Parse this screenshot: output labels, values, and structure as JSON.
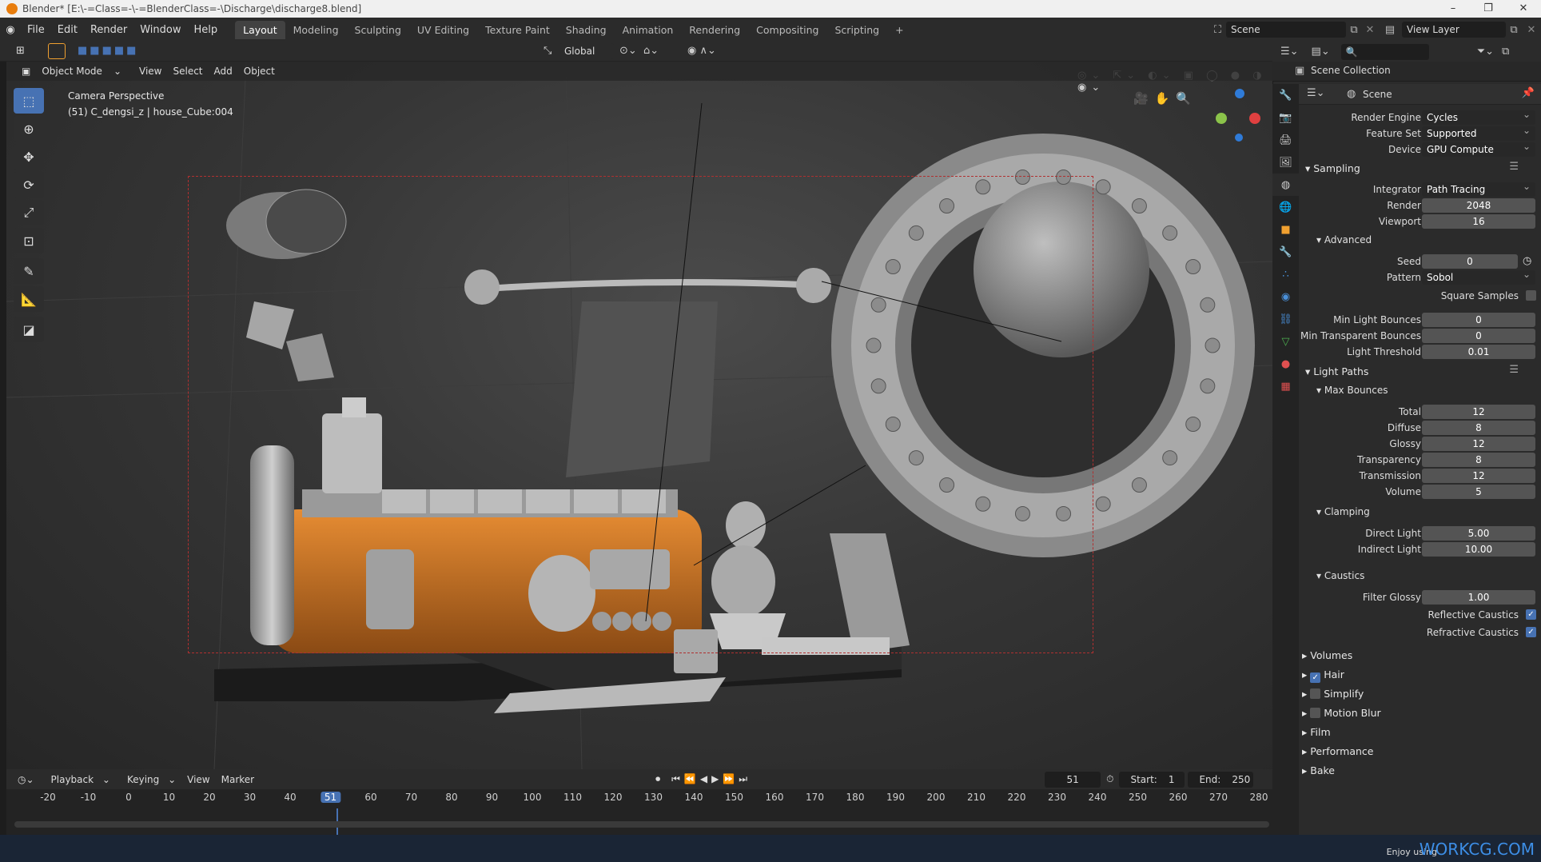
{
  "window": {
    "title": "Blender* [E:\\-=Class=-\\-=BlenderClass=-\\Discharge\\discharge8.blend]"
  },
  "menu": [
    "File",
    "Edit",
    "Render",
    "Window",
    "Help"
  ],
  "workspaces": [
    "Layout",
    "Modeling",
    "Sculpting",
    "UV Editing",
    "Texture Paint",
    "Shading",
    "Animation",
    "Rendering",
    "Compositing",
    "Scripting"
  ],
  "active_workspace": "Layout",
  "scene_field": "Scene",
  "view_layer_field": "View Layer",
  "viewport": {
    "mode": "Object Mode",
    "menus": [
      "View",
      "Select",
      "Add",
      "Object"
    ],
    "orientation": "Global",
    "info_line1": "Camera Perspective",
    "info_line2": "(51) C_dengsi_z | house_Cube:004"
  },
  "outliner": {
    "collection": "Scene Collection"
  },
  "properties": {
    "context": "Scene",
    "render_engine": {
      "label": "Render Engine",
      "value": "Cycles"
    },
    "feature_set": {
      "label": "Feature Set",
      "value": "Supported"
    },
    "device": {
      "label": "Device",
      "value": "GPU Compute"
    },
    "sampling": {
      "title": "Sampling",
      "integrator_label": "Integrator",
      "integrator": "Path Tracing",
      "render_label": "Render",
      "render": "2048",
      "viewport_label": "Viewport",
      "viewport": "16",
      "advanced": "Advanced",
      "seed_label": "Seed",
      "seed": "0",
      "pattern_label": "Pattern",
      "pattern": "Sobol",
      "square_samples": "Square Samples",
      "min_light_bounces_label": "Min Light Bounces",
      "min_light_bounces": "0",
      "min_transparent_bounces_label": "Min Transparent Bounces",
      "min_transparent_bounces": "0",
      "light_threshold_label": "Light Threshold",
      "light_threshold": "0.01"
    },
    "light_paths": {
      "title": "Light Paths",
      "max_bounces": "Max Bounces",
      "total_label": "Total",
      "total": "12",
      "diffuse_label": "Diffuse",
      "diffuse": "8",
      "glossy_label": "Glossy",
      "glossy": "12",
      "transparency_label": "Transparency",
      "transparency": "8",
      "transmission_label": "Transmission",
      "transmission": "12",
      "volume_label": "Volume",
      "volume": "5",
      "clamping": "Clamping",
      "direct_light_label": "Direct Light",
      "direct_light": "5.00",
      "indirect_light_label": "Indirect Light",
      "indirect_light": "10.00",
      "caustics": "Caustics",
      "filter_glossy_label": "Filter Glossy",
      "filter_glossy": "1.00",
      "reflective_caustics": "Reflective Caustics",
      "refractive_caustics": "Refractive Caustics"
    },
    "panels": [
      "Volumes",
      "Hair",
      "Simplify",
      "Motion Blur",
      "Film",
      "Performance",
      "Bake"
    ]
  },
  "timeline": {
    "menus": [
      "Playback",
      "Keying",
      "View",
      "Marker"
    ],
    "current_frame": "51",
    "start_label": "Start:",
    "start": "1",
    "end_label": "End:",
    "end": "250",
    "ticks": [
      "-20",
      "-10",
      "0",
      "10",
      "20",
      "30",
      "40",
      "51",
      "60",
      "70",
      "80",
      "90",
      "100",
      "110",
      "120",
      "130",
      "140",
      "150",
      "160",
      "170",
      "180",
      "190",
      "200",
      "210",
      "220",
      "230",
      "240",
      "250",
      "260",
      "270",
      "280"
    ]
  },
  "watermark": {
    "prefix": "Enjoy using",
    "brand": "WORKCG.COM"
  },
  "colors": {
    "accent": "#4772b3",
    "orange": "#d87a26",
    "camera_frame": "#b03030"
  }
}
